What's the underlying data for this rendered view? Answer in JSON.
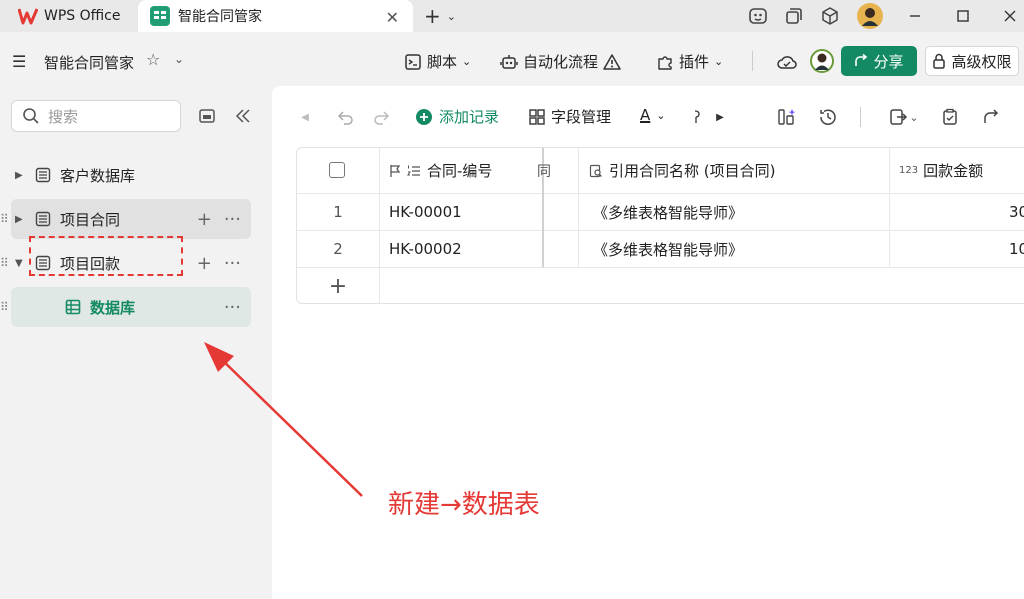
{
  "titlebar": {
    "wps_tab": "WPS Office",
    "active_tab": "智能合同管家",
    "close_glyph": "✕",
    "new_tab_glyph": "+",
    "icons": [
      "smart-face-icon",
      "window-restore-icon",
      "cube-icon",
      "avatar",
      "minimize-icon",
      "maximize-icon",
      "close-window-icon"
    ]
  },
  "toolbar": {
    "menu_glyph": "☰",
    "doc_title": "智能合同管家",
    "star_glyph": "☆",
    "script": "脚本",
    "automation": "自动化流程",
    "plugins": "插件",
    "share": "分享",
    "permission": "高级权限"
  },
  "sidebar": {
    "search_placeholder": "搜索",
    "items": [
      {
        "label": "客户数据库"
      },
      {
        "label": "项目合同"
      },
      {
        "label": "项目回款"
      },
      {
        "label": "数据库"
      }
    ]
  },
  "grid_toolbar": {
    "add_record": "添加记录",
    "field_manage": "字段管理",
    "font_a": "A"
  },
  "table": {
    "columns": [
      "合同-编号",
      "引用合同名称 (项目合同)",
      "回款金额"
    ],
    "partial_col_fragment": "同",
    "number_prefix": "123",
    "rows": [
      {
        "no": "1",
        "code": "HK-00001",
        "name": "《多维表格智能导师》",
        "amount": "30"
      },
      {
        "no": "2",
        "code": "HK-00002",
        "name": "《多维表格智能导师》",
        "amount": "10"
      }
    ],
    "add_row_glyph": "+"
  },
  "annotation": {
    "text": "新建→数据表"
  },
  "colors": {
    "brand_green": "#138a63",
    "annotation_red": "#e53935"
  }
}
